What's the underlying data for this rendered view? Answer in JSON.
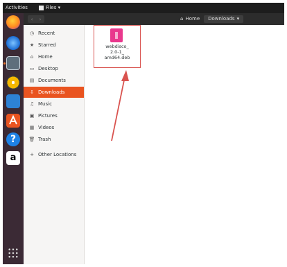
{
  "topbar": {
    "activities": "Activities",
    "app_menu": "Files ▾"
  },
  "dock": {
    "apps": [
      "firefox-icon",
      "thunderbird-icon",
      "files-icon",
      "rhythmbox-icon",
      "libreoffice-writer-icon",
      "software-center-icon",
      "help-icon",
      "amazon-icon",
      "show-applications-icon"
    ],
    "help_glyph": "?",
    "amazon_glyph": "a"
  },
  "header": {
    "back": "‹",
    "forward": "›",
    "path": [
      {
        "label": "Home",
        "icon": "home-icon"
      },
      {
        "label": "Downloads",
        "icon": "chevron-down-icon"
      }
    ]
  },
  "sidebar": {
    "items": [
      {
        "label": "Recent",
        "icon": "clock-icon"
      },
      {
        "label": "Starred",
        "icon": "star-icon"
      },
      {
        "label": "Home",
        "icon": "home-icon"
      },
      {
        "label": "Desktop",
        "icon": "desktop-icon"
      },
      {
        "label": "Documents",
        "icon": "documents-icon"
      },
      {
        "label": "Downloads",
        "icon": "download-icon",
        "active": true
      },
      {
        "label": "Music",
        "icon": "music-icon"
      },
      {
        "label": "Pictures",
        "icon": "pictures-icon"
      },
      {
        "label": "Videos",
        "icon": "videos-icon"
      },
      {
        "label": "Trash",
        "icon": "trash-icon"
      },
      {
        "label": "Other Locations",
        "icon": "plus-icon"
      }
    ]
  },
  "files": [
    {
      "name": "webdisco_\n2.0-1_\namd64.deb",
      "icon": "deb-package-icon"
    }
  ],
  "colors": {
    "accent": "#e95420",
    "annotation": "#d9534f",
    "deb_icon": "#e9388d"
  }
}
